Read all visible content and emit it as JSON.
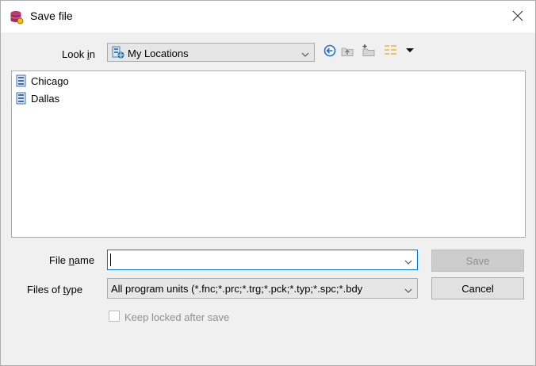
{
  "window": {
    "title": "Save file",
    "app_icon": "database-icon",
    "close_icon": "close-icon"
  },
  "look_in": {
    "label_pre": "Look ",
    "label_underline": "i",
    "label_post": "n",
    "value": "My Locations"
  },
  "toolbar": {
    "icons": [
      "back-icon",
      "up-folder-icon",
      "new-folder-icon",
      "view-menu-icon",
      "view-dropdown-icon"
    ]
  },
  "file_list": {
    "items": [
      {
        "name": "Chicago",
        "icon": "server-icon"
      },
      {
        "name": "Dallas",
        "icon": "server-icon"
      }
    ]
  },
  "file_name": {
    "label_pre": "File ",
    "label_underline": "n",
    "label_post": "ame",
    "value": ""
  },
  "file_type": {
    "label_pre": "Files of ",
    "label_underline": "t",
    "label_post": "ype",
    "value": "All program units (*.fnc;*.prc;*.trg;*.pck;*.typ;*.spc;*.bdy"
  },
  "buttons": {
    "save": "Save",
    "cancel": "Cancel"
  },
  "keep_locked": {
    "label": "Keep locked after save",
    "checked": false
  },
  "colors": {
    "accent": "#0078d7",
    "icon_db": "#b5306a"
  }
}
